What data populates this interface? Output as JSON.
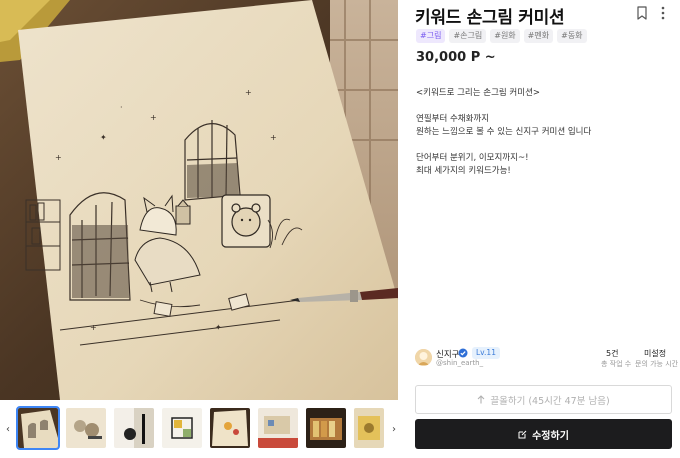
{
  "product": {
    "title": "키워드 손그림 커미션",
    "tags": [
      "#그림",
      "#손그림",
      "#원화",
      "#펜화",
      "#동화"
    ],
    "price": "30,000 P ~",
    "description": [
      "<키워드로 그리는 손그림 커미션>",
      "",
      "연필부터 수채화까지",
      "원하는 느낌으로 볼 수 있는 신지구 커미션 입니다",
      "",
      "단어부터 분위기, 이모지까지~!",
      "최대 세가지의 키워드가능!"
    ]
  },
  "seller": {
    "name": "신지구",
    "level": "Lv.11",
    "handle": "@shin_earth_"
  },
  "stats": [
    {
      "value": "5건",
      "label": "총 작업 수"
    },
    {
      "value": "미설정",
      "label": "문의 가능 시간"
    }
  ],
  "actions": {
    "pull": "끌올하기 (45시간 47분 남음)",
    "edit": "수정하기"
  },
  "gallery": {
    "thumbnail_count": 8,
    "selected_index": 0
  },
  "icons": {
    "bookmark": "bookmark-icon",
    "more": "more-vertical-icon",
    "prev": "chevron-left-icon",
    "next": "chevron-right-icon",
    "pull": "arrow-up-icon",
    "edit": "edit-icon",
    "verified": "verified-icon"
  },
  "colors": {
    "tag_primary_bg": "#eee8fd",
    "tag_primary_text": "#7a5cf0",
    "tag_bg": "#f1f1f4",
    "level_badge": "#3b7bd8",
    "edit_button": "#1c1c1e",
    "selected_thumb": "#3e86f5"
  }
}
